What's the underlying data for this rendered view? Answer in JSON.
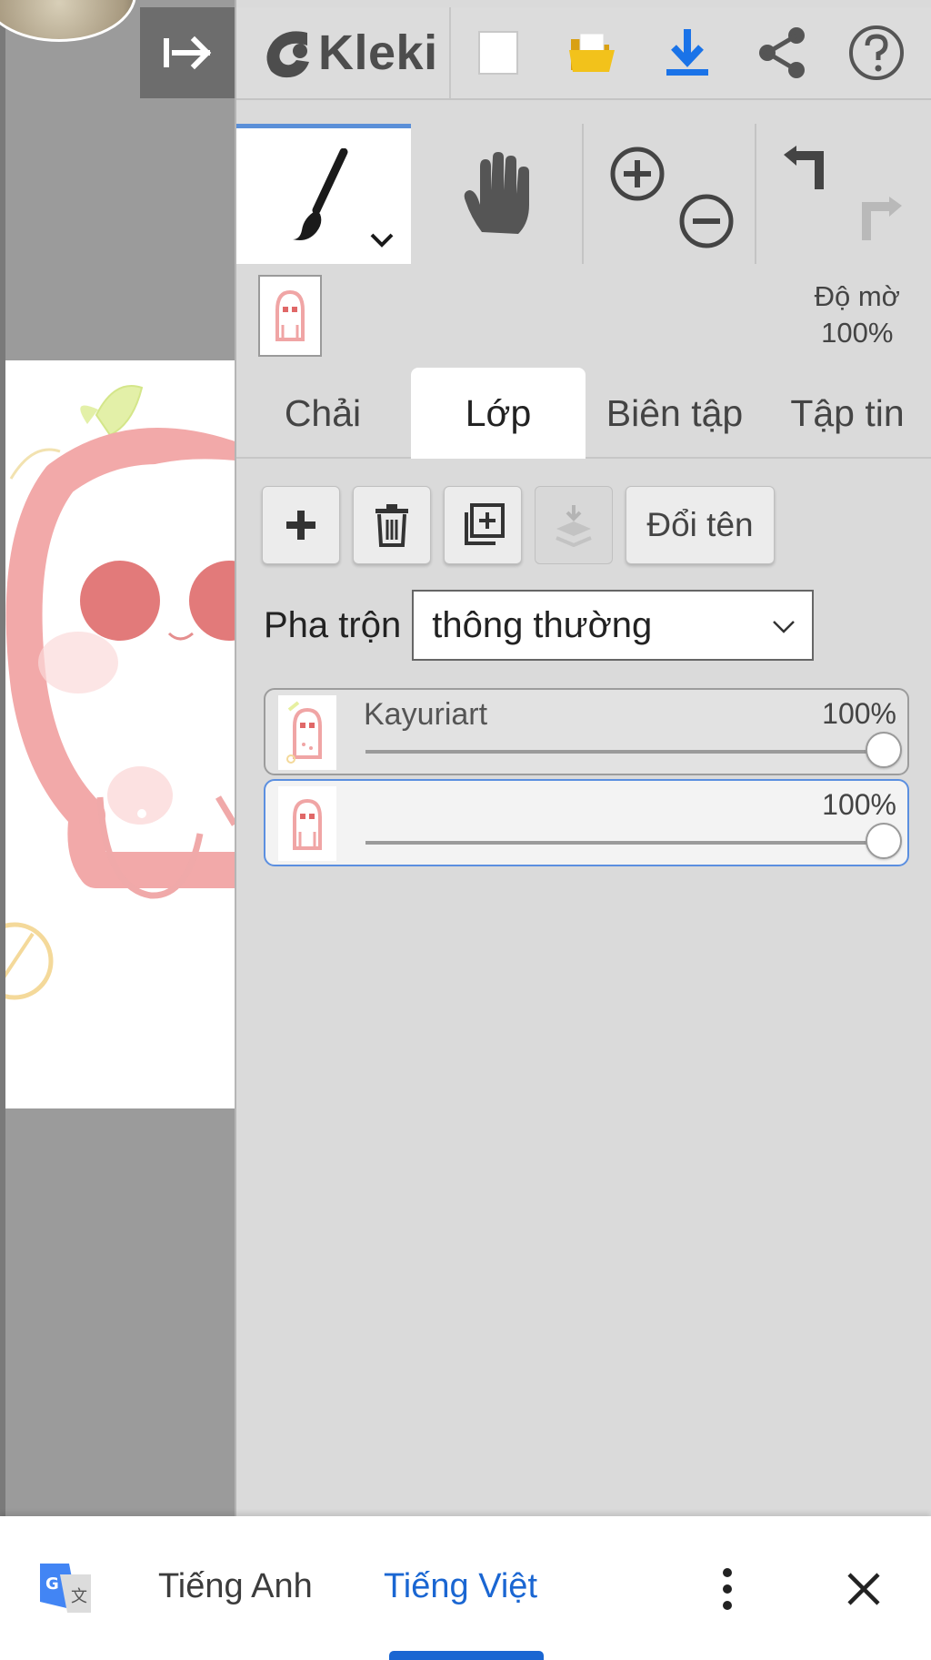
{
  "app": {
    "logo_text": "Kleki"
  },
  "toolbar": {
    "icons": [
      "collapse-panel-icon",
      "new-document-icon",
      "open-folder-icon",
      "download-icon",
      "share-icon",
      "help-icon"
    ],
    "accent_color": "#1a73e8"
  },
  "tools": {
    "active": "brush",
    "items": [
      "brush-icon",
      "hand-icon",
      "zoom-in-icon",
      "zoom-out-icon",
      "undo-icon",
      "redo-icon"
    ]
  },
  "layer_info": {
    "opacity_label": "Độ mờ",
    "opacity_value": "100%"
  },
  "tabs": [
    {
      "label": "Chải",
      "active": false
    },
    {
      "label": "Lớp",
      "active": true
    },
    {
      "label": "Biên tập",
      "active": false
    },
    {
      "label": "Tập tin",
      "active": false
    }
  ],
  "layer_actions": {
    "rename_label": "Đổi tên"
  },
  "blend": {
    "label": "Pha trộn",
    "value": "thông thường"
  },
  "layers": [
    {
      "name": "Kayuriart",
      "opacity_label": "100%",
      "opacity": 1.0,
      "active": false
    },
    {
      "name": "",
      "opacity_label": "100%",
      "opacity": 1.0,
      "active": true
    }
  ],
  "translate_bar": {
    "source_lang": "Tiếng Anh",
    "target_lang": "Tiếng Việt",
    "active_color": "#1a66d2"
  }
}
